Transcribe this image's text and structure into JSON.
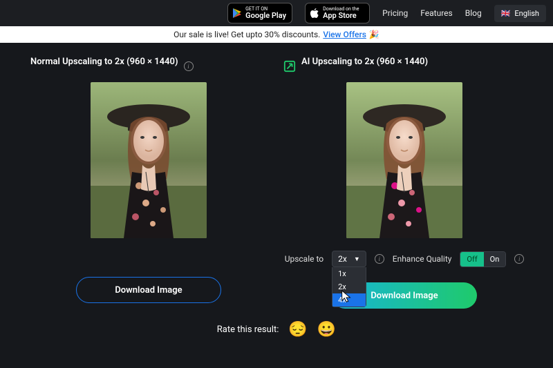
{
  "topbar": {
    "google_play": {
      "tiny": "GET IT ON",
      "big": "Google Play"
    },
    "app_store": {
      "tiny": "Download on the",
      "big": "App Store"
    },
    "nav": {
      "pricing": "Pricing",
      "features": "Features",
      "blog": "Blog"
    },
    "lang": "English"
  },
  "promo": {
    "text": "Our sale is live! Get upto 30% discounts.",
    "link": "View Offers",
    "emoji": "🎉"
  },
  "left_panel": {
    "title": "Normal Upscaling to 2x (960 × 1440)",
    "download": "Download Image"
  },
  "right_panel": {
    "title": "AI Upscaling to 2x (960 × 1440)",
    "upscale_label": "Upscale to",
    "upscale_value": "2x",
    "upscale_options": {
      "o1": "1x",
      "o2": "2x",
      "o3": "4x"
    },
    "enhance_label": "Enhance Quality",
    "toggle": {
      "off": "Off",
      "on": "On"
    },
    "download": "Download Image"
  },
  "rate": {
    "label": "Rate this result:",
    "sad": "😔",
    "happy": "😀"
  }
}
